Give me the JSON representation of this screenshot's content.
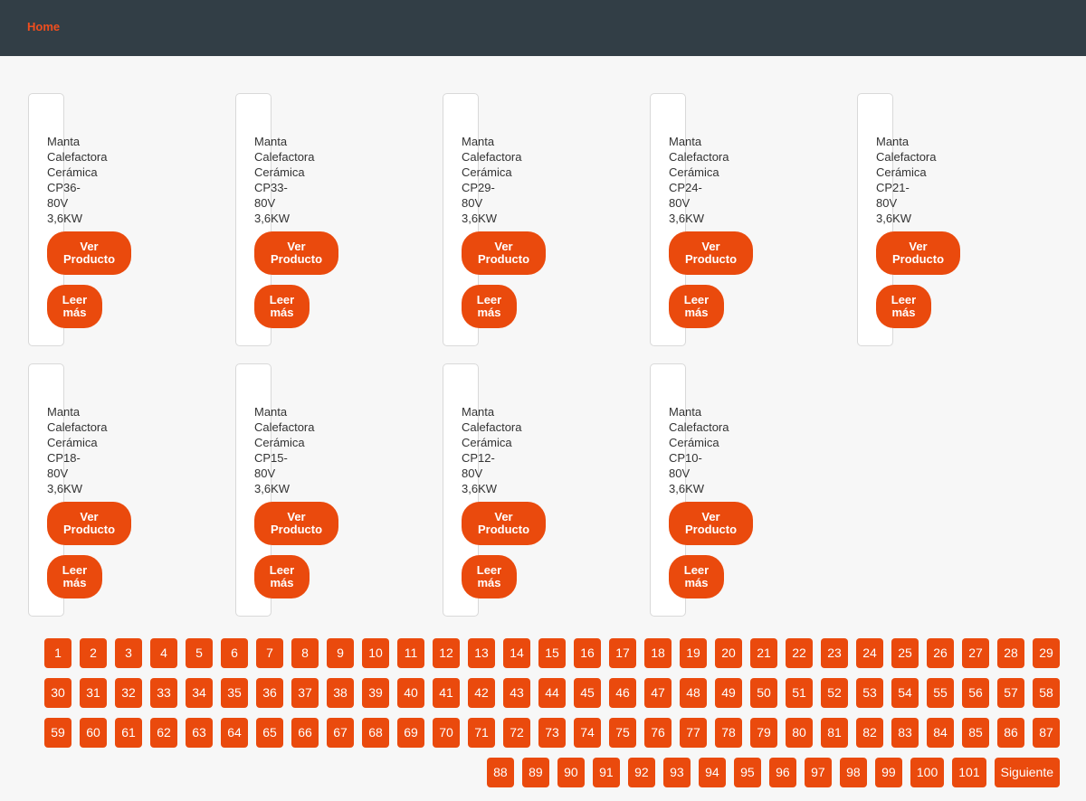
{
  "nav": {
    "home_label": "Home"
  },
  "products": [
    {
      "title": "Manta\nCalefactora\nCerámica\nCP36-\n80V\n3,6KW",
      "view_label": "Ver\nProducto",
      "more_label": "Leer\nmás"
    },
    {
      "title": "Manta\nCalefactora\nCerámica\nCP33-\n80V\n3,6KW",
      "view_label": "Ver\nProducto",
      "more_label": "Leer\nmás"
    },
    {
      "title": "Manta\nCalefactora\nCerámica\nCP29-\n80V\n3,6KW",
      "view_label": "Ver\nProducto",
      "more_label": "Leer\nmás"
    },
    {
      "title": "Manta\nCalefactora\nCerámica\nCP24-\n80V\n3,6KW",
      "view_label": "Ver\nProducto",
      "more_label": "Leer\nmás"
    },
    {
      "title": "Manta\nCalefactora\nCerámica\nCP21-\n80V\n3,6KW",
      "view_label": "Ver\nProducto",
      "more_label": "Leer\nmás"
    },
    {
      "title": "Manta\nCalefactora\nCerámica\nCP18-\n80V\n3,6KW",
      "view_label": "Ver\nProducto",
      "more_label": "Leer\nmás"
    },
    {
      "title": "Manta\nCalefactora\nCerámica\nCP15-\n80V\n3,6KW",
      "view_label": "Ver\nProducto",
      "more_label": "Leer\nmás"
    },
    {
      "title": "Manta\nCalefactora\nCerámica\nCP12-\n80V\n3,6KW",
      "view_label": "Ver\nProducto",
      "more_label": "Leer\nmás"
    },
    {
      "title": "Manta\nCalefactora\nCerámica\nCP10-\n80V\n3,6KW",
      "view_label": "Ver\nProducto",
      "more_label": "Leer\nmás"
    }
  ],
  "pagination": {
    "pages": [
      "1",
      "2",
      "3",
      "4",
      "5",
      "6",
      "7",
      "8",
      "9",
      "10",
      "11",
      "12",
      "13",
      "14",
      "15",
      "16",
      "17",
      "18",
      "19",
      "20",
      "21",
      "22",
      "23",
      "24",
      "25",
      "26",
      "27",
      "28",
      "29",
      "30",
      "31",
      "32",
      "33",
      "34",
      "35",
      "36",
      "37",
      "38",
      "39",
      "40",
      "41",
      "42",
      "43",
      "44",
      "45",
      "46",
      "47",
      "48",
      "49",
      "50",
      "51",
      "52",
      "53",
      "54",
      "55",
      "56",
      "57",
      "58",
      "59",
      "60",
      "61",
      "62",
      "63",
      "64",
      "65",
      "66",
      "67",
      "68",
      "69",
      "70",
      "71",
      "72",
      "73",
      "74",
      "75",
      "76",
      "77",
      "78",
      "79",
      "80",
      "81",
      "82",
      "83",
      "84",
      "85",
      "86",
      "87",
      "88",
      "89",
      "90",
      "91",
      "92",
      "93",
      "94",
      "95",
      "96",
      "97",
      "98",
      "99",
      "100",
      "101"
    ],
    "next_label": "Siguiente"
  },
  "colors": {
    "accent": "#ea4a0d",
    "header": "#323e46",
    "background": "#f7f7f7"
  }
}
